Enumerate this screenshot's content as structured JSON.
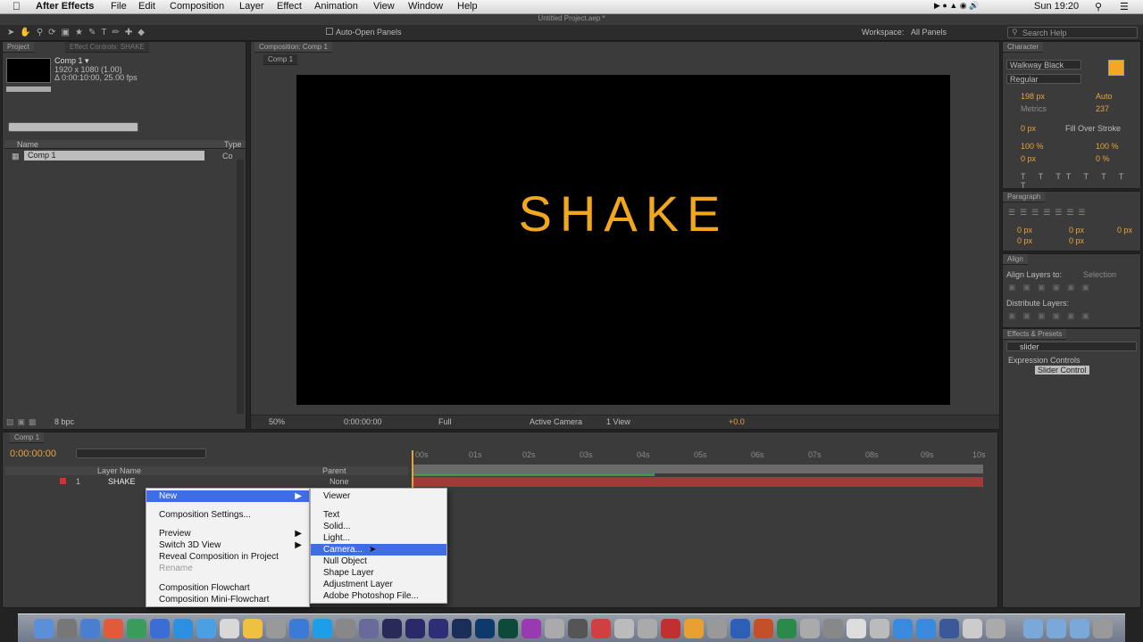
{
  "menubar": {
    "app": "After Effects",
    "items": [
      "File",
      "Edit",
      "Composition",
      "Layer",
      "Effect",
      "Animation",
      "View",
      "Window",
      "Help"
    ],
    "clock": "Sun 19:20"
  },
  "window_title": "Untitled Project.aep *",
  "toolbar": {
    "auto_open": "Auto-Open Panels",
    "workspace_label": "Workspace:",
    "workspace_value": "All Panels",
    "search_help": "Search Help"
  },
  "project": {
    "tab": "Project",
    "tab2": "Effect Controls: SHAKE",
    "comp_name": "Comp 1 ▾",
    "comp_info1": "1920 x 1080 (1.00)",
    "comp_info2": "Δ 0:00:10:00, 25.00 fps",
    "col_name": "Name",
    "col_type": "Type",
    "item": "Comp 1",
    "item_type": "Co",
    "bpc": "8 bpc"
  },
  "viewer": {
    "tab": "Composition: Comp 1",
    "subtab": "Comp 1",
    "text": "SHAKE",
    "text_color": "#f2a81d",
    "zoom": "50%",
    "timecode": "0:00:00:00",
    "resolution": "Full",
    "camera": "Active Camera",
    "views": "1 View",
    "exposure": "+0.0"
  },
  "timeline": {
    "tab": "Comp 1",
    "timecode": "0:00:00:00",
    "col_layer": "Layer Name",
    "col_parent": "Parent",
    "layer_num": "1",
    "layer_name": "SHAKE",
    "parent": "None",
    "ticks": [
      "00s",
      "01s",
      "02s",
      "03s",
      "04s",
      "05s",
      "06s",
      "07s",
      "08s",
      "09s",
      "10s"
    ]
  },
  "context_menu": {
    "items": [
      "New",
      "Composition Settings...",
      "Preview",
      "Switch 3D View",
      "Reveal Composition in Project",
      "Rename",
      "Composition Flowchart",
      "Composition Mini-Flowchart"
    ]
  },
  "submenu": {
    "items": [
      "Viewer",
      "Text",
      "Solid...",
      "Light...",
      "Camera...",
      "Null Object",
      "Shape Layer",
      "Adjustment Layer",
      "Adobe Photoshop File..."
    ]
  },
  "character": {
    "tab": "Character",
    "font": "Walkway Black",
    "style": "Regular",
    "size": "198 px",
    "leading": "Auto",
    "kerning": "Metrics",
    "tracking": "237",
    "stroke": "0 px",
    "stroke_mode": "Fill Over Stroke",
    "vscale": "100 %",
    "hscale": "100 %",
    "baseline": "0 px",
    "tsume": "0 %"
  },
  "paragraph": {
    "tab": "Paragraph",
    "indent1": "0 px",
    "indent2": "0 px",
    "indent3": "0 px",
    "space1": "0 px",
    "space2": "0 px"
  },
  "align": {
    "tab": "Align",
    "align_to": "Align Layers to:",
    "align_val": "Selection",
    "distribute": "Distribute Layers:"
  },
  "effects": {
    "tab": "Effects & Presets",
    "search": "slider",
    "category": "Expression Controls",
    "result": "Slider Control"
  }
}
